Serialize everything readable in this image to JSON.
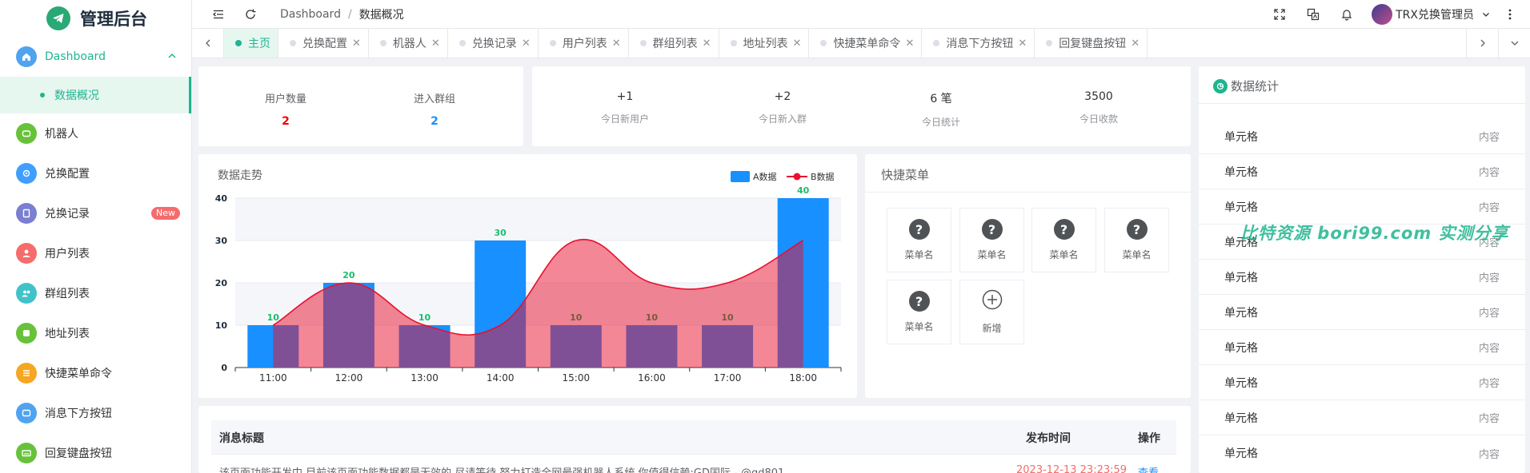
{
  "app": {
    "title": "管理后台"
  },
  "sidebar": {
    "items": [
      {
        "label": "Dashboard",
        "color": "#4fa3f0"
      },
      {
        "label": "数据概况"
      },
      {
        "label": "机器人",
        "color": "#67c23a"
      },
      {
        "label": "兑换配置",
        "color": "#409eff"
      },
      {
        "label": "兑换记录",
        "color": "#7a7fd1",
        "badge": "New"
      },
      {
        "label": "用户列表",
        "color": "#f56c6c"
      },
      {
        "label": "群组列表",
        "color": "#3fc3c9"
      },
      {
        "label": "地址列表",
        "color": "#67c23a"
      },
      {
        "label": "快捷菜单命令",
        "color": "#f5a623"
      },
      {
        "label": "消息下方按钮",
        "color": "#4fa3f0"
      },
      {
        "label": "回复键盘按钮",
        "color": "#67c23a"
      }
    ]
  },
  "header": {
    "breadcrumb": [
      "Dashboard",
      "数据概况"
    ],
    "user": "TRX兑换管理员"
  },
  "tabs": [
    "主页",
    "兑换配置",
    "机器人",
    "兑换记录",
    "用户列表",
    "群组列表",
    "地址列表",
    "快捷菜单命令",
    "消息下方按钮",
    "回复键盘按钮"
  ],
  "stats_left": [
    {
      "label": "用户数量",
      "value": "2",
      "color": "#f00000"
    },
    {
      "label": "进入群组",
      "value": "2",
      "color": "#1890ff"
    }
  ],
  "stats_today": [
    {
      "value": "+1",
      "label": "今日新用户"
    },
    {
      "value": "+2",
      "label": "今日新入群"
    },
    {
      "value": "6 笔",
      "label": "今日统计"
    },
    {
      "value": "3500",
      "label": "今日收款"
    }
  ],
  "chart_data": {
    "type": "bar",
    "title": "数据走势",
    "categories": [
      "11:00",
      "12:00",
      "13:00",
      "14:00",
      "15:00",
      "16:00",
      "17:00",
      "18:00"
    ],
    "series": [
      {
        "name": "A数据",
        "type": "bar",
        "color": "#1890ff",
        "values": [
          10,
          20,
          10,
          30,
          10,
          10,
          10,
          40
        ]
      },
      {
        "name": "B数据",
        "type": "line",
        "color": "#e8102e",
        "values": [
          10,
          20,
          10,
          10,
          30,
          20,
          20,
          30
        ]
      }
    ],
    "ylim": [
      0,
      40
    ],
    "yticks": [
      0,
      10,
      20,
      30,
      40
    ],
    "legend": "top-right"
  },
  "quick_menu": {
    "title": "快捷菜单",
    "items": [
      "菜单名",
      "菜单名",
      "菜单名",
      "菜单名",
      "菜单名"
    ],
    "add_label": "新增"
  },
  "stats_panel": {
    "title": "数据统计",
    "rows": [
      {
        "k": "单元格",
        "v": "内容"
      },
      {
        "k": "单元格",
        "v": "内容"
      },
      {
        "k": "单元格",
        "v": "内容"
      },
      {
        "k": "单元格",
        "v": "内容"
      },
      {
        "k": "单元格",
        "v": "内容"
      },
      {
        "k": "单元格",
        "v": "内容"
      },
      {
        "k": "单元格",
        "v": "内容"
      },
      {
        "k": "单元格",
        "v": "内容"
      },
      {
        "k": "单元格",
        "v": "内容"
      },
      {
        "k": "单元格",
        "v": "内容"
      }
    ]
  },
  "messages": {
    "headers": [
      "消息标题",
      "发布时间",
      "操作"
    ],
    "rows": [
      {
        "title": "该页面功能开发中,目前该页面功能数据都是无效的,尽请等待,努力打造全网最强机器人系统,你值得信赖;GD国际 - @gd801",
        "time": "2023-12-13 23:23:59",
        "action": "查看"
      }
    ]
  },
  "watermark": "比特资源 bori99.com 实测分享"
}
